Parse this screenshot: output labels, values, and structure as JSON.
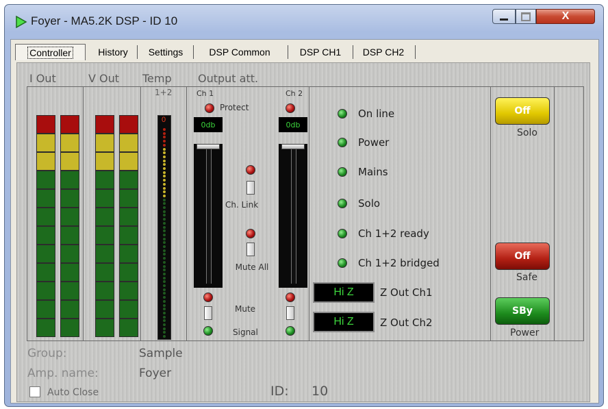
{
  "window": {
    "title": "Foyer - MA5.2K DSP - ID 10",
    "close_glyph": "X"
  },
  "tabs": [
    {
      "label": "Controller",
      "active": true
    },
    {
      "label": "History",
      "active": false
    },
    {
      "label": "Settings",
      "active": false
    },
    {
      "label": "DSP Common",
      "active": false
    },
    {
      "label": "DSP CH1",
      "active": false
    },
    {
      "label": "DSP CH2",
      "active": false
    }
  ],
  "meters": {
    "i_out_label": "I Out",
    "v_out_label": "V Out",
    "temp_label": "Temp",
    "temp_sub": "1+2",
    "temp_top": "0",
    "output_att_label": "Output att."
  },
  "output": {
    "ch1_label": "Ch 1",
    "ch2_label": "Ch 2",
    "protect_label": "Protect",
    "ch1_db": "0db",
    "ch2_db": "0db",
    "ch_link_label": "Ch. Link",
    "mute_all_label": "Mute All",
    "mute_label": "Mute",
    "signal_label": "Signal"
  },
  "status": {
    "items": [
      "On line",
      "Power",
      "Mains",
      "Solo",
      "Ch 1+2 ready",
      "Ch 1+2 bridged"
    ],
    "z_out": [
      {
        "value": "Hi Z",
        "label": "Z Out Ch1"
      },
      {
        "value": "Hi Z",
        "label": "Z Out Ch2"
      }
    ]
  },
  "buttons": {
    "solo": {
      "value": "Off",
      "label": "Solo"
    },
    "safe": {
      "value": "Off",
      "label": "Safe"
    },
    "power": {
      "value": "SBy",
      "label": "Power"
    }
  },
  "info": {
    "group_label": "Group:",
    "group_value": "Sample",
    "amp_name_label": "Amp. name:",
    "amp_name_value": "Foyer",
    "auto_close_label": "Auto Close",
    "id_label": "ID:",
    "id_value": "10"
  },
  "colors": {
    "led_red": "#b01515",
    "led_green": "#1f8f24",
    "meter_red": "#a80d0d",
    "meter_yellow": "#c8b82a",
    "meter_green": "#1d6b1d",
    "display_text": "#3cd43c"
  }
}
